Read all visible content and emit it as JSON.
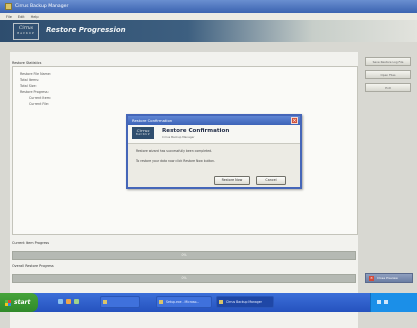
{
  "window": {
    "title": "Cirrus Backup Manager",
    "menu": [
      "File",
      "Edit",
      "Help"
    ]
  },
  "banner": {
    "logo_line1": "Cirrus",
    "logo_line2": "BACKUP",
    "heading": "Restore Progression"
  },
  "statistics": {
    "label": "Restore Statistics",
    "items": [
      "Restore File Name:",
      "Total Items:",
      "Total Size:",
      "Restore Progress:",
      "Current Item:",
      "Current File:"
    ]
  },
  "side_buttons": [
    "Save Restore Log File",
    "Open Files",
    "Exit"
  ],
  "progress": {
    "current_label": "Current Item Progress",
    "current_percent": "0%",
    "current_value": 0,
    "overall_label": "Overall Restore Progress",
    "overall_percent": "0%",
    "overall_value": 0
  },
  "close_preview": {
    "label": "Close Preview",
    "icon": "close-icon"
  },
  "dialog": {
    "title": "Restore Confirmation",
    "logo_line1": "Cirrus",
    "logo_line2": "BACKUP",
    "header_title": "Restore Confirmation",
    "header_subtitle": "Cirrus Backup Manager",
    "message1": "Restore wizard has successfully been completed.",
    "message2": "To restore your data now click Restore Now button.",
    "restore_button": "Restore Now",
    "cancel_button": "Cancel"
  },
  "taskbar": {
    "start_label": "start",
    "tasks": [
      "",
      "Setup.exe - Microso...",
      "Cirrus Backup Manager"
    ],
    "clock": ""
  },
  "colors": {
    "titlebar": "#3b63b0",
    "dialog_border": "#4566b8",
    "progress_track": "#b5b9b3",
    "taskbar": "#2552be",
    "start_button": "#2f8a2a"
  }
}
